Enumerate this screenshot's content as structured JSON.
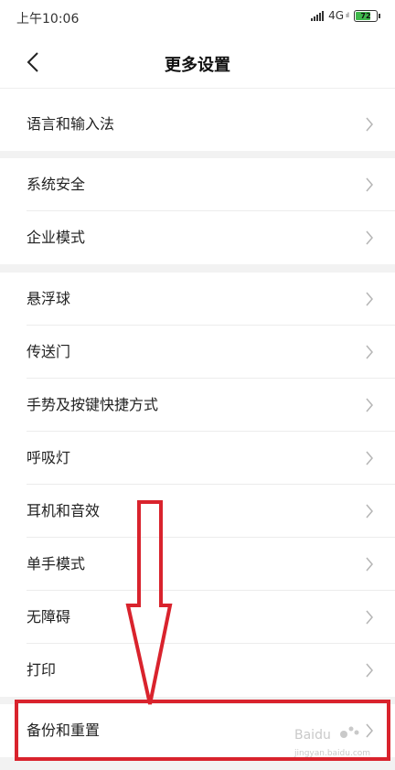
{
  "status_bar": {
    "time": "上午10:06",
    "network": "4G",
    "network_sub": "ıl",
    "battery_level": "72",
    "battery_fraction": 0.72,
    "battery_color": "#3fb84b"
  },
  "header": {
    "back_icon": "chevron-left-icon",
    "title": "更多设置"
  },
  "sections": [
    {
      "items": [
        {
          "label": "语言和输入法"
        }
      ]
    },
    {
      "items": [
        {
          "label": "系统安全"
        },
        {
          "label": "企业模式"
        }
      ]
    },
    {
      "items": [
        {
          "label": "悬浮球"
        },
        {
          "label": "传送门"
        },
        {
          "label": "手势及按键快捷方式"
        },
        {
          "label": "呼吸灯"
        },
        {
          "label": "耳机和音效"
        },
        {
          "label": "单手模式"
        },
        {
          "label": "无障碍"
        },
        {
          "label": "打印"
        }
      ]
    },
    {
      "items": [
        {
          "label": "备份和重置"
        }
      ]
    }
  ],
  "annotation": {
    "color": "#d9232d",
    "highlighted_item": "备份和重置"
  },
  "watermark": {
    "brand": "Baidu",
    "sub": "jingyan.baidu.com"
  }
}
